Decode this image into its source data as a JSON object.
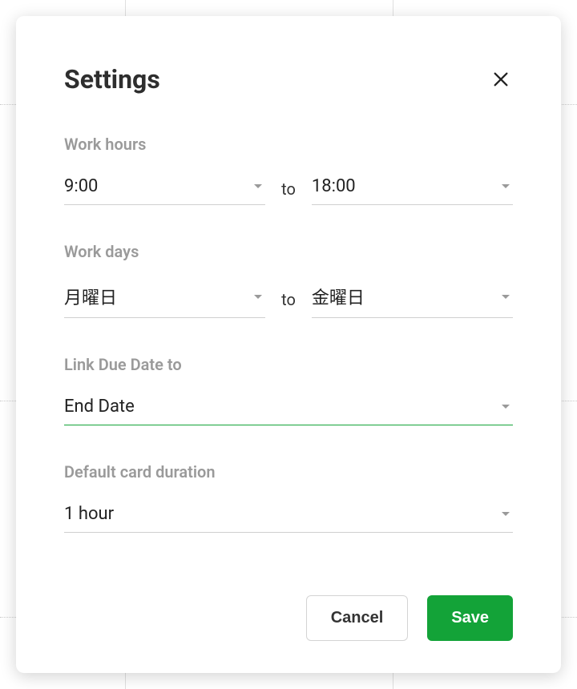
{
  "modal": {
    "title": "Settings"
  },
  "work_hours": {
    "label": "Work hours",
    "from": "9:00",
    "to_label": "to",
    "to": "18:00"
  },
  "work_days": {
    "label": "Work days",
    "from": "月曜日",
    "to_label": "to",
    "to": "金曜日"
  },
  "link_due_date": {
    "label": "Link Due Date to",
    "value": "End Date"
  },
  "default_duration": {
    "label": "Default card duration",
    "value": "1 hour"
  },
  "buttons": {
    "cancel": "Cancel",
    "save": "Save"
  }
}
